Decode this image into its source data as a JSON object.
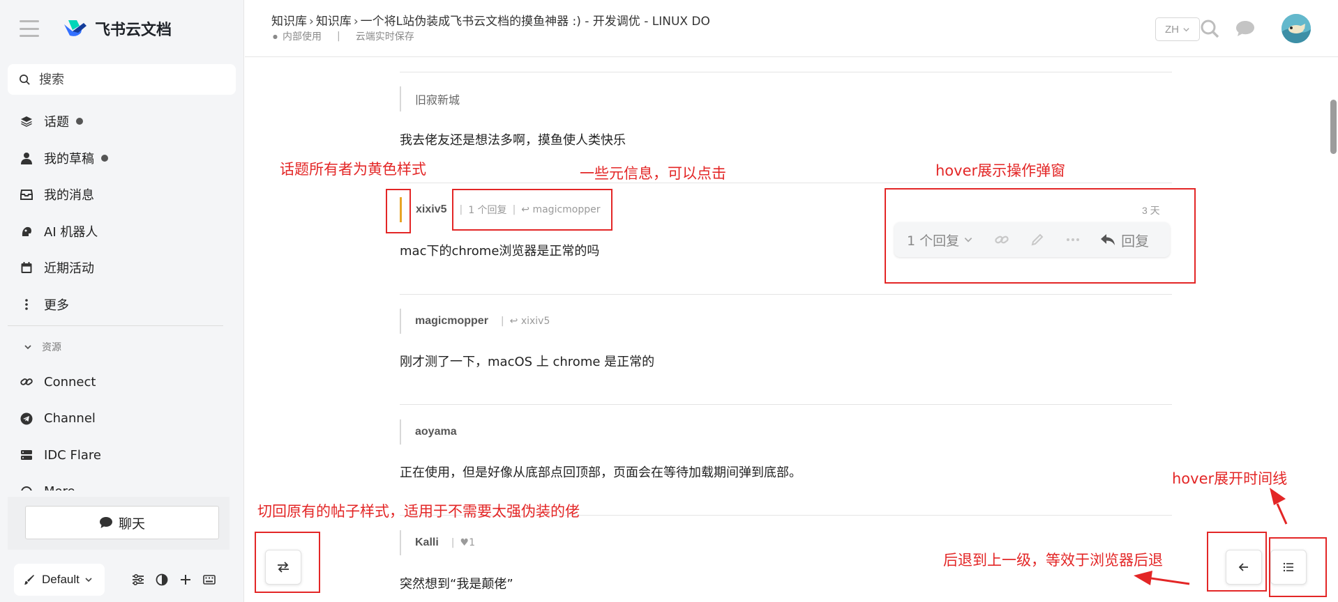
{
  "sidebar": {
    "brand_name": "飞书云文档",
    "search_placeholder": "搜索",
    "items": [
      {
        "label": "话题",
        "icon": "layers-icon",
        "has_dot": true
      },
      {
        "label": "我的草稿",
        "icon": "user-icon",
        "has_dot": true
      },
      {
        "label": "我的消息",
        "icon": "inbox-icon",
        "has_dot": false
      },
      {
        "label": "AI 机器人",
        "icon": "robot-icon",
        "has_dot": false
      },
      {
        "label": "近期活动",
        "icon": "calendar-icon",
        "has_dot": false
      },
      {
        "label": "更多",
        "icon": "vertical-ellipsis-icon",
        "has_dot": false
      }
    ],
    "section_label": "资源",
    "resources": [
      {
        "label": "Connect",
        "icon": "link-icon"
      },
      {
        "label": "Channel",
        "icon": "telegram-icon"
      },
      {
        "label": "IDC Flare",
        "icon": "server-icon"
      },
      {
        "label": "More",
        "icon": "more-icon"
      }
    ],
    "chat_label": "聊天",
    "theme_label": "Default"
  },
  "topbar": {
    "breadcrumbs": [
      "知识库",
      "知识库",
      "一个将L站伪装成飞书云文档的摸鱼神器 :) - 开发调优 - LINUX DO"
    ],
    "meta_left": "内部使用",
    "meta_right": "云端实时保存",
    "lang": "ZH"
  },
  "posts": [
    {
      "author": "旧寂新城",
      "body": "我去佬友还是想法多啊，摸鱼使人类快乐"
    },
    {
      "author": "xixiv5",
      "reply_count": "1 个回复",
      "reply_to": "magicmopper",
      "body": "mac下的chrome浏览器是正常的吗",
      "date": "3 天",
      "is_owner": true
    },
    {
      "author": "magicmopper",
      "reply_to": "xixiv5",
      "body": "刚才测了一下，macOS 上 chrome 是正常的"
    },
    {
      "author": "aoyama",
      "body": "正在使用，但是好像从底部点回顶部，页面会在等待加载期间弹到底部。"
    },
    {
      "author": "Kalli",
      "likes": "1",
      "body": "突然想到“我是颠佬”"
    }
  ],
  "actionbar": {
    "replies_label": "1 个回复",
    "reply_label": "回复"
  },
  "annotations": {
    "owner_style": "话题所有者为黄色样式",
    "meta_info": "一些元信息，可以点击",
    "hover_popup": "hover展示操作弹窗",
    "hover_timeline": "hover展开时间线",
    "switch_style": "切回原有的帖子样式，适用于不需要太强伪装的佬",
    "back_level": "后退到上一级，等效于浏览器后退"
  },
  "colors": {
    "owner_bar": "#e7a526",
    "annotation": "#e32626",
    "brand_blue": "#3370ff"
  }
}
